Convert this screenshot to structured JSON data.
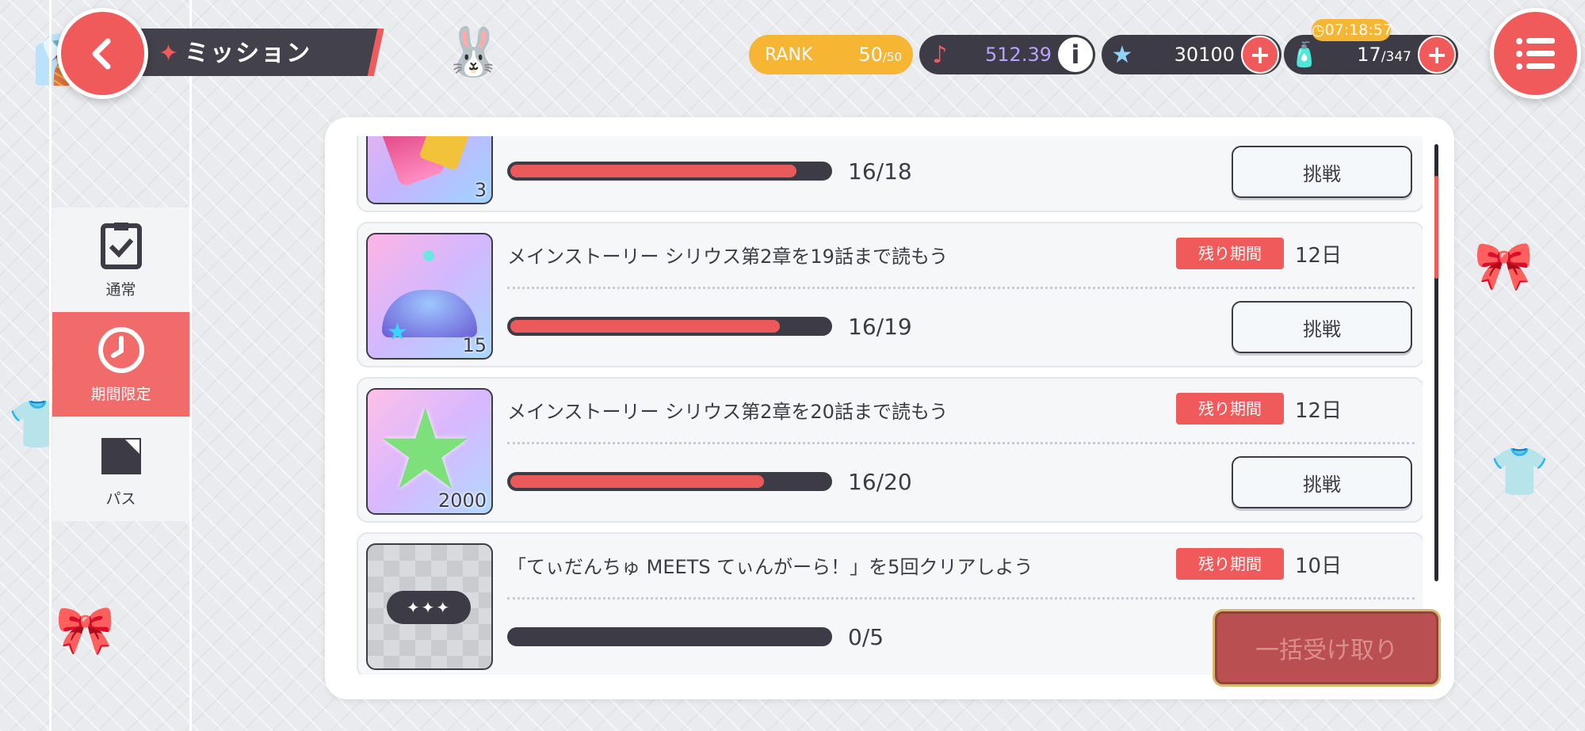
{
  "header": {
    "title": "ミッション",
    "rank_label": "RANK",
    "rank_value": "50",
    "rank_max": "/50",
    "music_value": "512.39",
    "star_value": "30100",
    "stamina_value": "17",
    "stamina_max": "/347",
    "timer": "07:18:57"
  },
  "tabs": [
    {
      "label": "通常"
    },
    {
      "label": "期間限定",
      "active": true
    },
    {
      "label": "パス"
    }
  ],
  "missions": [
    {
      "title": "",
      "qty": "3",
      "progress_text": "16/18",
      "progress": 0.889,
      "button": "挑戦"
    },
    {
      "title": "メインストーリー シリウス第2章を19話まで読もう",
      "remain_label": "残り期間",
      "remain_days": "12日",
      "qty": "15",
      "progress_text": "16/19",
      "progress": 0.842,
      "button": "挑戦"
    },
    {
      "title": "メインストーリー シリウス第2章を20話まで読もう",
      "remain_label": "残り期間",
      "remain_days": "12日",
      "qty": "2000",
      "progress_text": "16/20",
      "progress": 0.8,
      "button": "挑戦"
    },
    {
      "title": "「てぃだんちゅ MEETS てぃんがーら！」を5回クリアしよう",
      "remain_label": "残り期間",
      "remain_days": "10日",
      "qty": "",
      "progress_text": "0/5",
      "progress": 0.0,
      "button": ""
    }
  ],
  "bulk_receive": "一括受け取り",
  "colors": {
    "accent": "#f05a5a",
    "dark": "#3d3c46",
    "gold": "#f7b534"
  }
}
